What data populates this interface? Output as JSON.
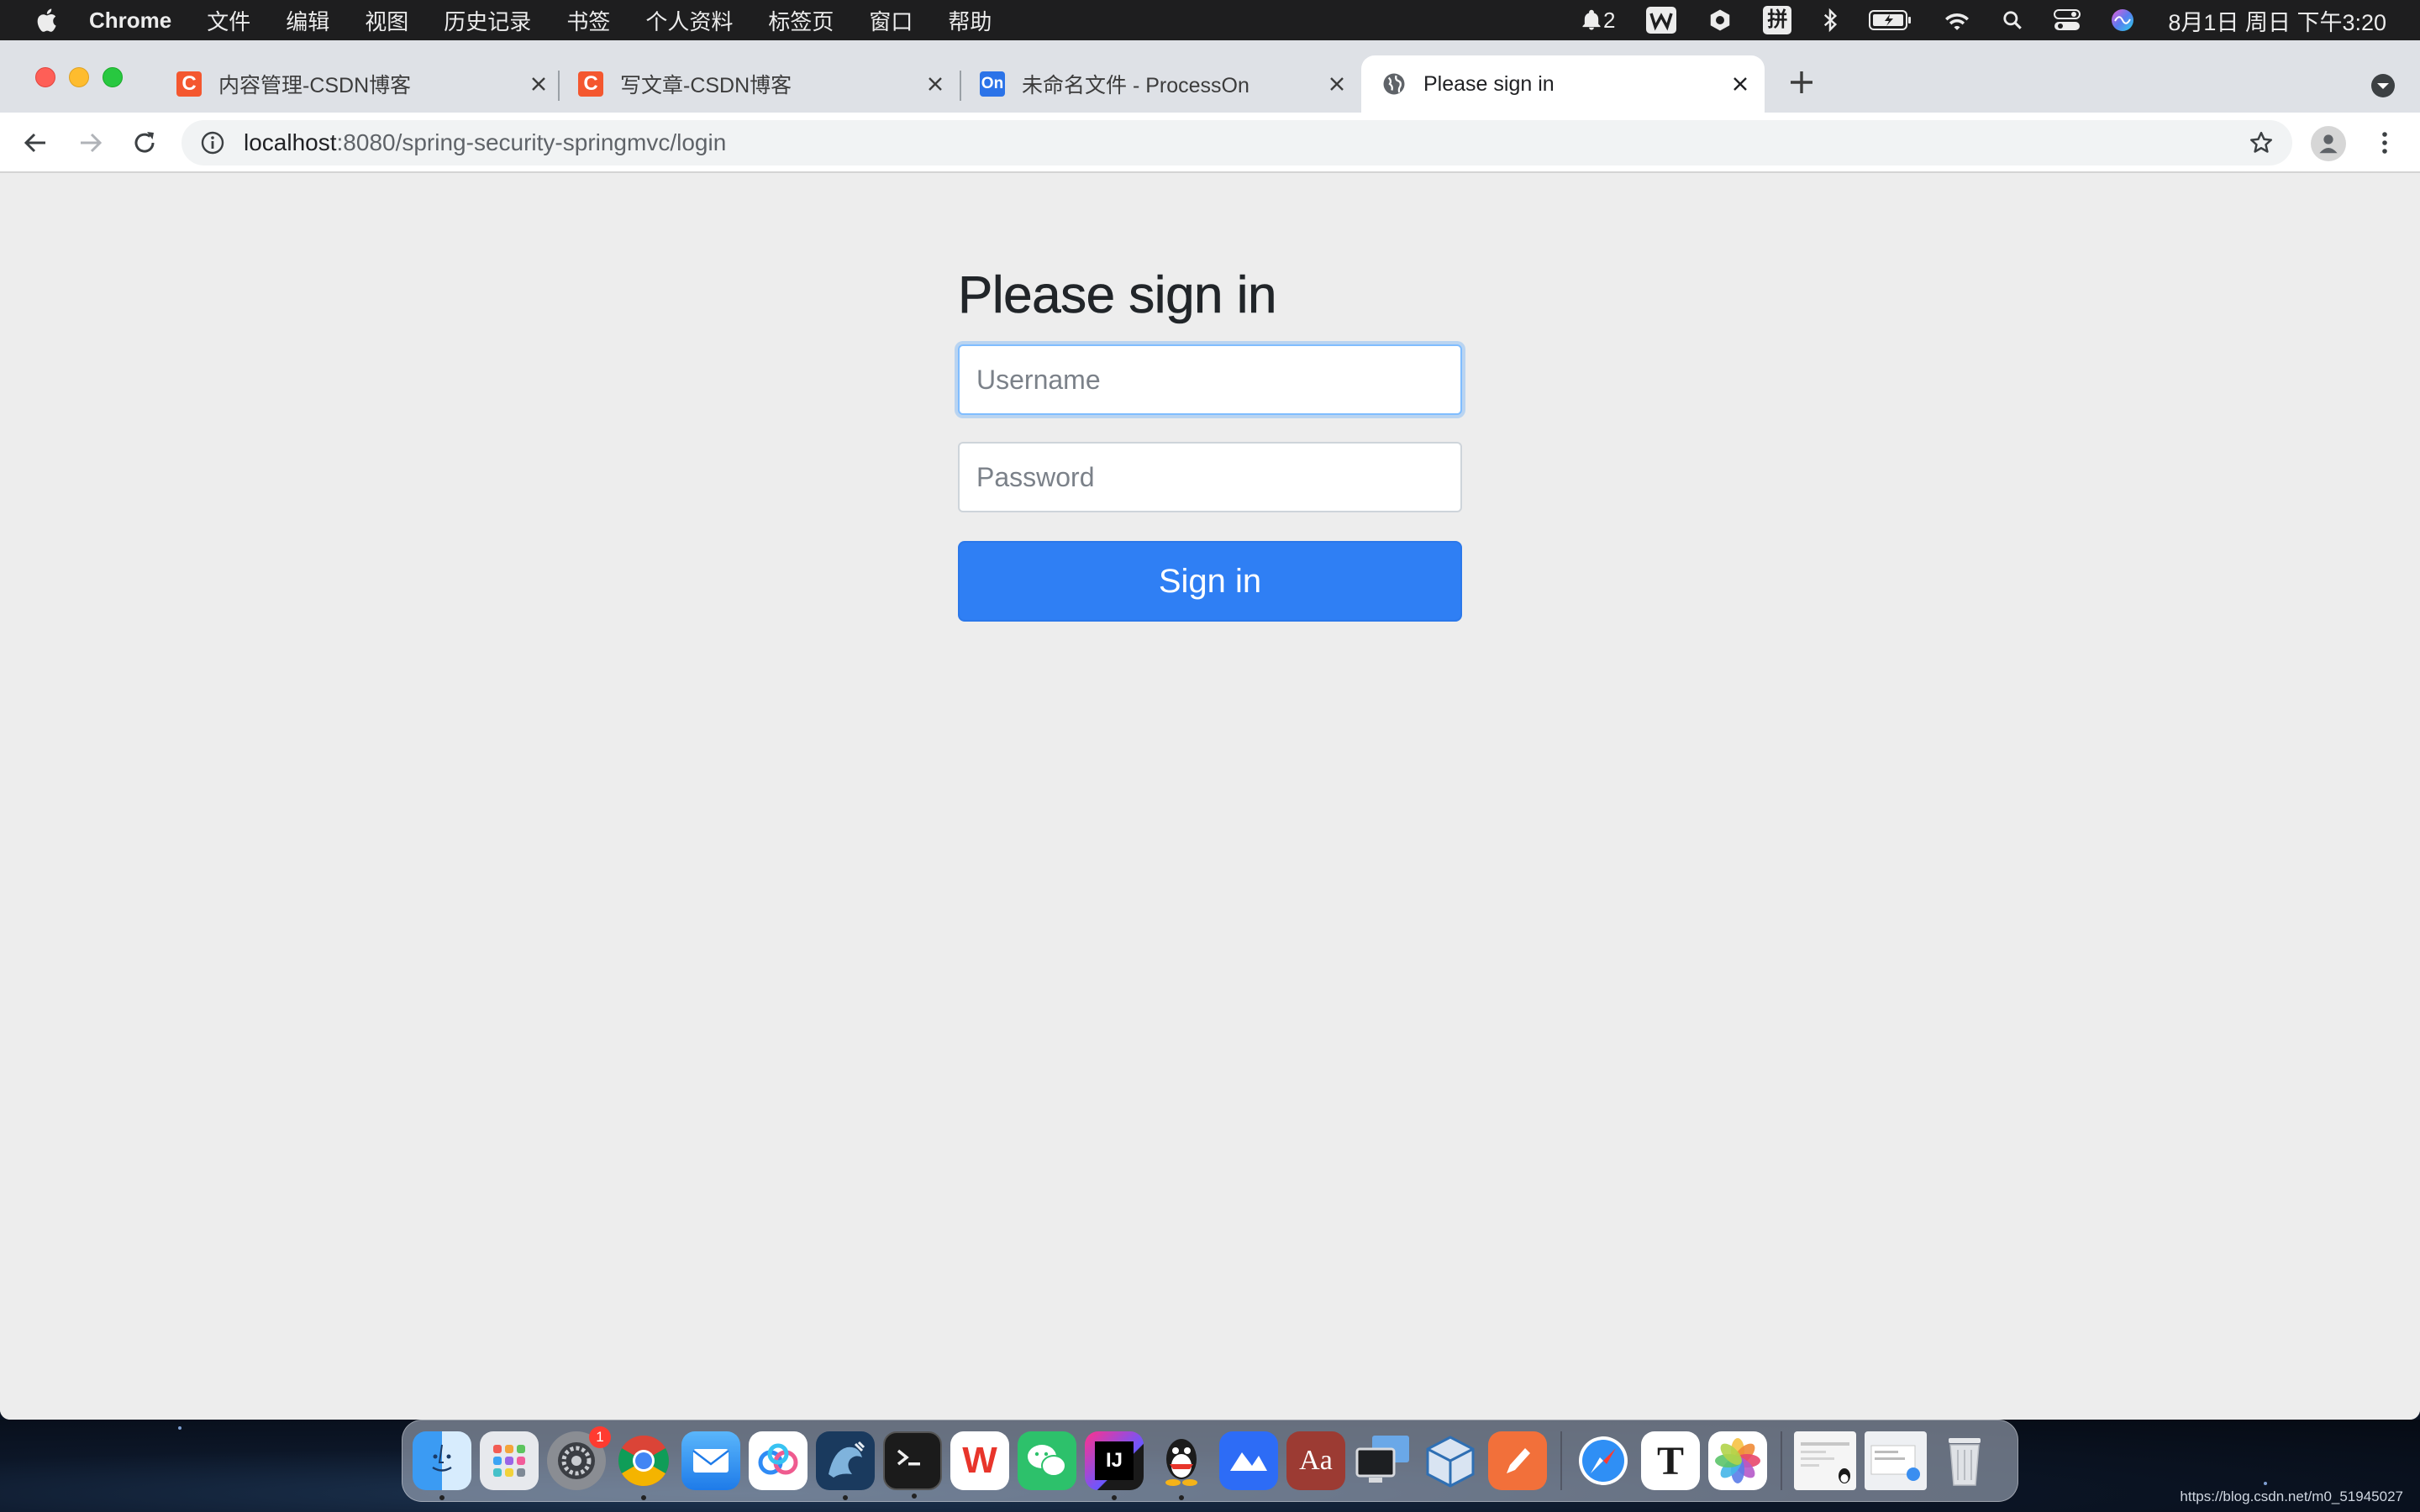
{
  "menubar": {
    "app_name": "Chrome",
    "items": [
      "文件",
      "编辑",
      "视图",
      "历史记录",
      "书签",
      "个人资料",
      "标签页",
      "窗口",
      "帮助"
    ],
    "notification_count": "2",
    "ime_label": "拼",
    "clock": "8月1日 周日 下午3:20"
  },
  "browser": {
    "tabs": [
      {
        "title": "内容管理-CSDN博客",
        "favicon": "csdn-icon",
        "favicon_text": "C"
      },
      {
        "title": "写文章-CSDN博客",
        "favicon": "csdn-icon",
        "favicon_text": "C"
      },
      {
        "title": "未命名文件 - ProcessOn",
        "favicon": "processon-icon",
        "favicon_text": "On"
      },
      {
        "title": "Please sign in",
        "favicon": "globe-icon",
        "active": true
      }
    ],
    "url_host": "localhost",
    "url_path": ":8080/spring-security-springmvc/login"
  },
  "login": {
    "heading": "Please sign in",
    "username_placeholder": "Username",
    "password_placeholder": "Password",
    "submit_label": "Sign in"
  },
  "dock": {
    "apps": [
      "finder-icon",
      "launchpad-icon",
      "system-preferences-icon",
      "chrome-icon",
      "mail-icon",
      "baidu-netdisk-icon",
      "mysql-workbench-icon",
      "terminal-icon",
      "wps-office-icon",
      "wechat-icon",
      "intellij-idea-icon",
      "qq-icon",
      "lark-icon",
      "dictionary-icon",
      "screen-sharing-icon",
      "virtualbox-icon",
      "pages-icon",
      "safari-icon",
      "typora-icon",
      "photos-icon"
    ],
    "settings_badge": "1",
    "wps_label": "W",
    "idea_label": "IJ",
    "dictionary_label": "Aa",
    "typora_label": "T"
  },
  "watermark": "https://blog.csdn.net/m0_51945027",
  "colors": {
    "primary": "#2f7ff4",
    "page_bg": "#ededed",
    "tab_strip": "#dee1e6",
    "csdn": "#f4572f",
    "processon": "#2b73e8"
  }
}
